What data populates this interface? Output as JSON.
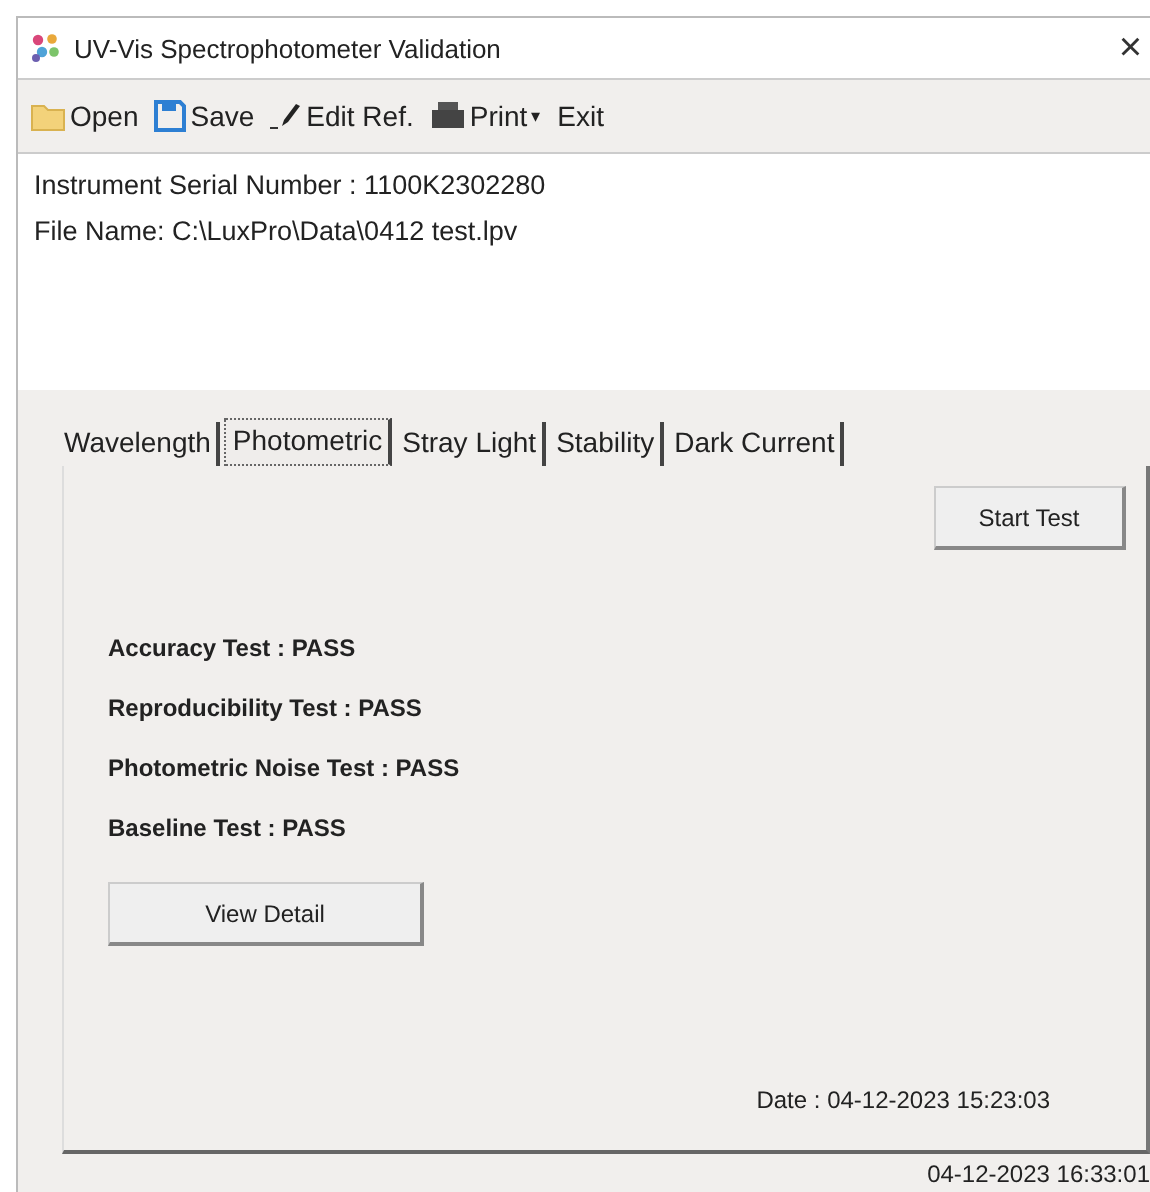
{
  "window": {
    "title": "UV-Vis Spectrophotometer Validation",
    "close": "×"
  },
  "toolbar": [
    {
      "kind": "open",
      "label": "Open"
    },
    {
      "kind": "save",
      "label": "Save"
    },
    {
      "kind": "edit",
      "label": "Edit Ref."
    },
    {
      "kind": "print",
      "label": "Print",
      "caret": "▾"
    },
    {
      "kind": "plain",
      "label": "Exit"
    }
  ],
  "info": [
    "Instrument Serial Number :  1100K2302280",
    "File Name: C:\\LuxPro\\Data\\0412 test.lpv"
  ],
  "tabs": [
    {
      "label": "Wavelength",
      "selected": false
    },
    {
      "label": "Photometric",
      "selected": true
    },
    {
      "label": "Stray Light",
      "selected": false
    },
    {
      "label": "Stability",
      "selected": false
    },
    {
      "label": "Dark Current",
      "selected": false
    }
  ],
  "start_button": "Start Test",
  "results": [
    "Accuracy Test : PASS",
    "Reproducibility Test : PASS",
    "Photometric Noise Test : PASS",
    "Baseline Test : PASS"
  ],
  "detail_button": "View Detail",
  "date": "Date : 04-12-2023 15:23:03",
  "status_bar": "04-12-2023 16:33:01"
}
